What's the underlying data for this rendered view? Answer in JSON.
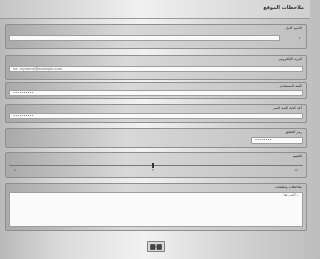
{
  "page": {
    "title": "ملاحظات الموقع"
  },
  "fields": {
    "name_label": "الاسم كامل",
    "name_value": "",
    "name_hint_left": "",
    "email_label": "البريد الإلكتروني",
    "email_placeholder": "ex: myname@example.com",
    "password_label": "كلمة المستخدم",
    "password_placeholder": "••••••••••",
    "confirm_label": "أعد كتابة كلمة السر",
    "confirm_placeholder": "••••••••••",
    "pin_label": "رمز التحقق",
    "pin_placeholder": "••••••••",
    "rating_label": "التقييم",
    "rating_min": "0",
    "rating_mid": "5",
    "rating_max": "10",
    "comments_label": "ملاحظات وتعليقات",
    "comments_placeholder": "أكتب هنا..."
  }
}
